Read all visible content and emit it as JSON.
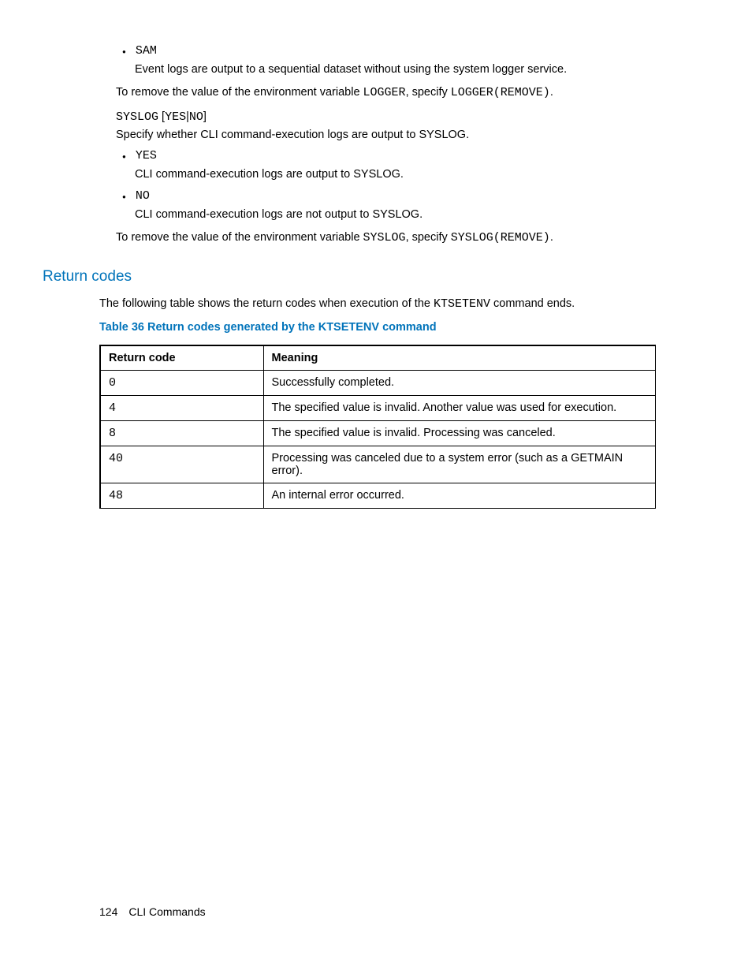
{
  "bullet1_code": "SAM",
  "bullet1_text": "Event logs are output to a sequential dataset without using the system logger service.",
  "remove1_a": "To remove the value of the environment variable ",
  "remove1_var": "LOGGER",
  "remove1_b": ", specify ",
  "remove1_code": "LOGGER(REMOVE)",
  "remove1_c": ".",
  "syslog_def_code_a": "SYSLOG",
  "syslog_def_bracket_open": "[",
  "syslog_def_yes": "YES",
  "syslog_def_pipe": "|",
  "syslog_def_no": "NO",
  "syslog_def_bracket_close": "]",
  "syslog_desc": "Specify whether CLI command-execution logs are output to SYSLOG.",
  "bullet2_code": "YES",
  "bullet2_text": "CLI command-execution logs are output to SYSLOG.",
  "bullet3_code": "NO",
  "bullet3_text": "CLI command-execution logs are not output to SYSLOG.",
  "remove2_a": "To remove the value of the environment variable ",
  "remove2_var": "SYSLOG",
  "remove2_b": ", specify ",
  "remove2_code": "SYSLOG(REMOVE)",
  "remove2_c": ".",
  "section_head": "Return codes",
  "intro_a": "The following table shows the return codes when execution of the ",
  "intro_code": "KTSETENV",
  "intro_b": " command ends.",
  "table_caption": "Table 36 Return codes generated by the KTSETENV command",
  "headers": {
    "c1": "Return code",
    "c2": "Meaning"
  },
  "rows": [
    {
      "code": "0",
      "meaning": "Successfully completed."
    },
    {
      "code": "4",
      "meaning": "The specified value is invalid. Another value was used for execution."
    },
    {
      "code": "8",
      "meaning": "The specified value is invalid. Processing was canceled."
    },
    {
      "code": "40",
      "meaning": "Processing was canceled due to a system error (such as a GETMAIN error)."
    },
    {
      "code": "48",
      "meaning": "An internal error occurred."
    }
  ],
  "footer_page": "124",
  "footer_title": "CLI Commands"
}
